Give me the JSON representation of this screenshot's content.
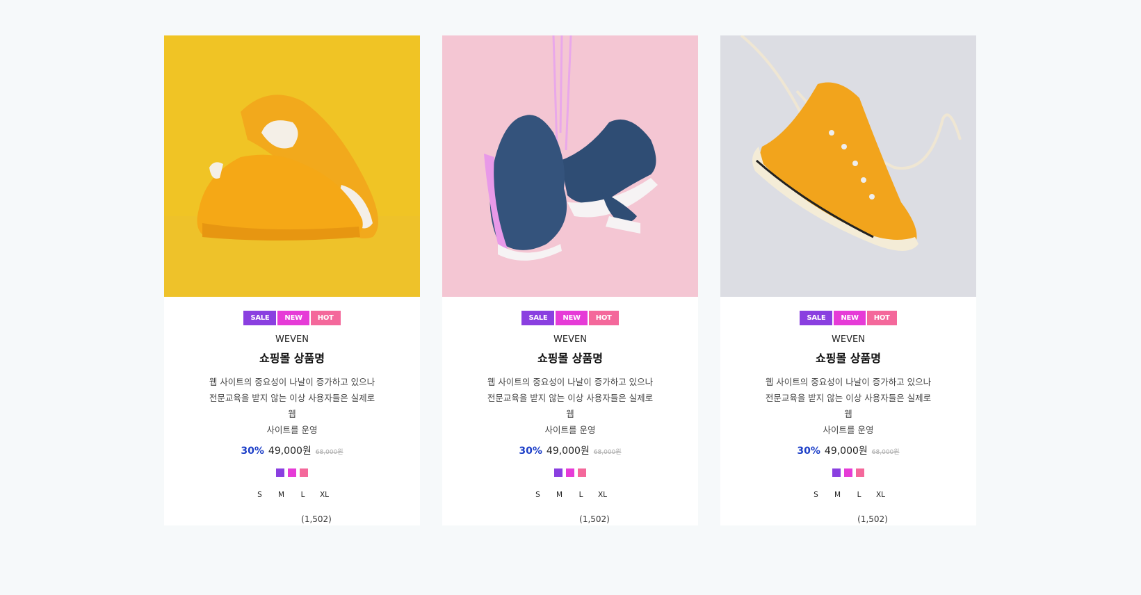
{
  "colors": {
    "sale": "#8a3fe0",
    "new": "#e63bd7",
    "hot": "#f4689b",
    "discount": "#1e40c8"
  },
  "products": [
    {
      "image": "yellow-sneakers-photo",
      "badges": [
        "SALE",
        "NEW",
        "HOT"
      ],
      "brand": "WEVEN",
      "name": "쇼핑몰 상품명",
      "desc": [
        "웹 사이트의 중요성이 나날이 증가하고 있으나",
        "전문교육을 받지 않는 이상 사용자들은 실제로 웹",
        "사이트를 운영"
      ],
      "discount": "30%",
      "price": "49,000원",
      "original_price": "68,000원",
      "swatches": [
        "#8a3fe0",
        "#e63bd7",
        "#f4689b"
      ],
      "sizes": [
        "S",
        "M",
        "L",
        "XL"
      ],
      "reviews": "(1,502)"
    },
    {
      "image": "navy-pink-sneakers-photo",
      "badges": [
        "SALE",
        "NEW",
        "HOT"
      ],
      "brand": "WEVEN",
      "name": "쇼핑몰 상품명",
      "desc": [
        "웹 사이트의 중요성이 나날이 증가하고 있으나",
        "전문교육을 받지 않는 이상 사용자들은 실제로 웹",
        "사이트를 운영"
      ],
      "discount": "30%",
      "price": "49,000원",
      "original_price": "68,000원",
      "swatches": [
        "#8a3fe0",
        "#e63bd7",
        "#f4689b"
      ],
      "sizes": [
        "S",
        "M",
        "L",
        "XL"
      ],
      "reviews": "(1,502)"
    },
    {
      "image": "orange-hightop-sneaker-photo",
      "badges": [
        "SALE",
        "NEW",
        "HOT"
      ],
      "brand": "WEVEN",
      "name": "쇼핑몰 상품명",
      "desc": [
        "웹 사이트의 중요성이 나날이 증가하고 있으나",
        "전문교육을 받지 않는 이상 사용자들은 실제로 웹",
        "사이트를 운영"
      ],
      "discount": "30%",
      "price": "49,000원",
      "original_price": "68,000원",
      "swatches": [
        "#8a3fe0",
        "#e63bd7",
        "#f4689b"
      ],
      "sizes": [
        "S",
        "M",
        "L",
        "XL"
      ],
      "reviews": "(1,502)"
    }
  ]
}
